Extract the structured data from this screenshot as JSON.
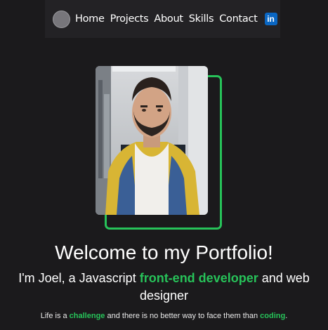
{
  "nav": {
    "links": [
      "Home",
      "Projects",
      "About",
      "Skills",
      "Contact"
    ],
    "linkedin_icon_text": "in"
  },
  "hero": {
    "title": "Welcome to my Portfolio!",
    "intro_prefix": "I'm Joel, a Javascript ",
    "intro_highlight": "front-end developer",
    "intro_suffix": " and web designer",
    "tagline_prefix": "Life is a ",
    "tagline_highlight_1": "challenge",
    "tagline_middle": " and there is no better way to face them than ",
    "tagline_highlight_2": "coding",
    "tagline_suffix": "."
  },
  "colors": {
    "background": "#1b1a1c",
    "navbar": "#232225",
    "accent": "#27c259",
    "linkedin": "#0a66c2"
  },
  "icons": {
    "avatar": "avatar-circle",
    "linkedin": "linkedin-icon"
  }
}
